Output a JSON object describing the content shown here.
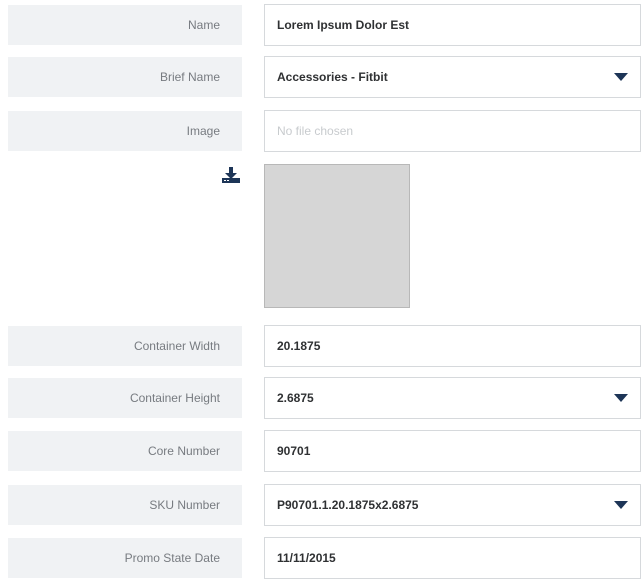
{
  "form": {
    "name": {
      "label": "Name",
      "value": "Lorem Ipsum Dolor Est"
    },
    "brief_name": {
      "label": "Brief Name",
      "value": "Accessories - Fitbit"
    },
    "image": {
      "label": "Image",
      "placeholder": "No file chosen",
      "icon": "download-icon"
    },
    "container_width": {
      "label": "Container Width",
      "value": "20.1875"
    },
    "container_height": {
      "label": "Container Height",
      "value": "2.6875"
    },
    "core_number": {
      "label": "Core Number",
      "value": "90701"
    },
    "sku_number": {
      "label": "SKU Number",
      "value": "P90701.1.20.1875x2.6875"
    },
    "promo_state_date": {
      "label": "Promo State Date",
      "value": "11/11/2015"
    }
  },
  "colors": {
    "label_bg": "#f0f2f4",
    "caret": "#1d3557",
    "preview_bg": "#d6d6d6"
  }
}
